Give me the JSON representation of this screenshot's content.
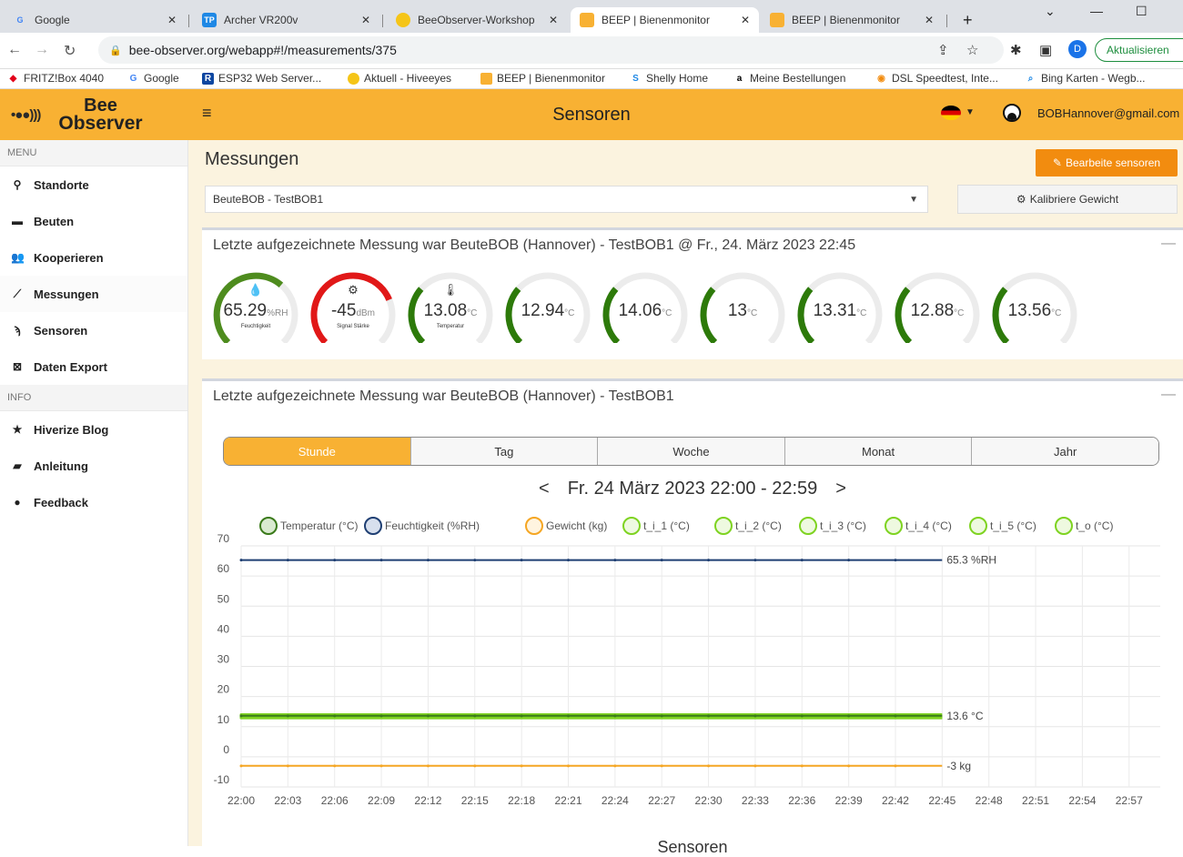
{
  "browser": {
    "tabs": [
      {
        "title": "Google",
        "icon": "G",
        "color": "#4285f4"
      },
      {
        "title": "Archer VR200v",
        "icon": "TP",
        "color": "#1e88e5"
      },
      {
        "title": "BeeObserver-Workshop",
        "icon": "",
        "color": "#f5c518"
      },
      {
        "title": "BEEP | Bienenmonitor",
        "icon": "",
        "color": "#f8b133"
      },
      {
        "title": "BEEP | Bienenmonitor",
        "icon": "",
        "color": "#f8b133"
      }
    ],
    "url": "bee-observer.org/webapp#!/measurements/375",
    "update_label": "Aktualisieren",
    "profile_initial": "D",
    "bookmarks": [
      "FRITZ!Box 4040",
      "Google",
      "ESP32 Web Server...",
      "Aktuell - Hiveeyes",
      "BEEP | Bienenmonitor",
      "Shelly Home",
      "Meine Bestellungen",
      "DSL Speedtest, Inte...",
      "Bing Karten - Wegb..."
    ]
  },
  "header": {
    "logo_line1": "Bee",
    "logo_line2": "Observer",
    "title": "Sensoren",
    "user_email": "BOBHannover@gmail.com"
  },
  "sidebar": {
    "menu_heading": "MENU",
    "info_heading": "INFO",
    "menu_items": [
      {
        "label": "Standorte",
        "icon": "map-marker-icon"
      },
      {
        "label": "Beuten",
        "icon": "archive-icon"
      },
      {
        "label": "Kooperieren",
        "icon": "users-icon"
      },
      {
        "label": "Messungen",
        "icon": "line-chart-icon"
      },
      {
        "label": "Sensoren",
        "icon": "rss-icon"
      },
      {
        "label": "Daten Export",
        "icon": "file-excel-icon"
      }
    ],
    "info_items": [
      {
        "label": "Hiverize Blog",
        "icon": "star-icon"
      },
      {
        "label": "Anleitung",
        "icon": "book-icon"
      },
      {
        "label": "Feedback",
        "icon": "comment-icon"
      }
    ]
  },
  "main": {
    "title": "Messungen",
    "edit_button": "Bearbeite sensoren",
    "calibrate_button": "Kalibriere Gewicht",
    "hive_selected": "BeuteBOB - TestBOB1",
    "last_measurement_title": "Letzte aufgezeichnete Messung war BeuteBOB (Hannover) - TestBOB1 @ Fr., 24. März 2023 22:45",
    "chart_panel_title": "Letzte aufgezeichnete Messung war BeuteBOB (Hannover) - TestBOB1",
    "period_tabs": [
      "Stunde",
      "Tag",
      "Woche",
      "Monat",
      "Jahr"
    ],
    "active_period": "Stunde",
    "date_range": "Fr. 24 März 2023 22:00 - 22:59",
    "prev_label": "<",
    "next_label": ">",
    "bottom_title": "Sensoren"
  },
  "gauges": [
    {
      "value": "65.29",
      "unit": "%RH",
      "label": "Feuchtigkeit",
      "icon": "humidity-icon",
      "glyph": "💧",
      "color": "#4e8c1e",
      "fraction": 0.65
    },
    {
      "value": "-45",
      "unit": "dBm",
      "label": "Signal Stärke",
      "icon": "gear-icon",
      "glyph": "⚙",
      "color": "#e11818",
      "fraction": 0.75
    },
    {
      "value": "13.08",
      "unit": "°C",
      "label": "Temperatur",
      "icon": "thermometer-icon",
      "glyph": "🌡",
      "color": "#2d7a0a",
      "fraction": 0.32
    },
    {
      "value": "12.94",
      "unit": "°C",
      "label": "",
      "icon": "",
      "glyph": "",
      "color": "#2d7a0a",
      "fraction": 0.32
    },
    {
      "value": "14.06",
      "unit": "°C",
      "label": "",
      "icon": "",
      "glyph": "",
      "color": "#2d7a0a",
      "fraction": 0.32
    },
    {
      "value": "13",
      "unit": "°C",
      "label": "",
      "icon": "",
      "glyph": "",
      "color": "#2d7a0a",
      "fraction": 0.32
    },
    {
      "value": "13.31",
      "unit": "°C",
      "label": "",
      "icon": "",
      "glyph": "",
      "color": "#2d7a0a",
      "fraction": 0.32
    },
    {
      "value": "12.88",
      "unit": "°C",
      "label": "",
      "icon": "",
      "glyph": "",
      "color": "#2d7a0a",
      "fraction": 0.32
    },
    {
      "value": "13.56",
      "unit": "°C",
      "label": "",
      "icon": "",
      "glyph": "",
      "color": "#2d7a0a",
      "fraction": 0.32
    }
  ],
  "chart_data": {
    "type": "line",
    "title": "",
    "xlabel": "",
    "ylabel": "",
    "ylim": [
      -10,
      70
    ],
    "yticks": [
      -10,
      0,
      10,
      20,
      30,
      40,
      50,
      60,
      70
    ],
    "x_ticks": [
      "22:00",
      "22:03",
      "22:06",
      "22:09",
      "22:12",
      "22:15",
      "22:18",
      "22:21",
      "22:24",
      "22:27",
      "22:30",
      "22:33",
      "22:36",
      "22:39",
      "22:42",
      "22:45",
      "22:48",
      "22:51",
      "22:54",
      "22:57"
    ],
    "grid": true,
    "legend_position": "top",
    "x_range_minutes": [
      0,
      59
    ],
    "series": [
      {
        "name": "Temperatur (°C)",
        "color": "#3a7a1a",
        "x_minutes": [
          0,
          45
        ],
        "values": [
          13.6,
          13.6
        ],
        "end_label": "13.6 °C"
      },
      {
        "name": "Feuchtigkeit (%RH)",
        "color": "#1f3f73",
        "x_minutes": [
          0,
          45
        ],
        "values": [
          65.3,
          65.3
        ],
        "end_label": "65.3 %RH"
      },
      {
        "name": "Gewicht (kg)",
        "color": "#f5a623",
        "x_minutes": [
          0,
          45
        ],
        "values": [
          -3,
          -3
        ],
        "end_label": "-3 kg"
      },
      {
        "name": "t_i_1 (°C)",
        "color": "#7ed321",
        "x_minutes": [
          0,
          45
        ],
        "values": [
          13,
          13
        ],
        "end_label": ""
      },
      {
        "name": "t_i_2 (°C)",
        "color": "#7ed321",
        "x_minutes": [
          0,
          45
        ],
        "values": [
          14,
          14
        ],
        "end_label": ""
      },
      {
        "name": "t_i_3 (°C)",
        "color": "#7ed321",
        "x_minutes": [
          0,
          45
        ],
        "values": [
          13,
          13
        ],
        "end_label": ""
      },
      {
        "name": "t_i_4 (°C)",
        "color": "#7ed321",
        "x_minutes": [
          0,
          45
        ],
        "values": [
          13.3,
          13.3
        ],
        "end_label": ""
      },
      {
        "name": "t_i_5 (°C)",
        "color": "#7ed321",
        "x_minutes": [
          0,
          45
        ],
        "values": [
          12.9,
          12.9
        ],
        "end_label": ""
      },
      {
        "name": "t_o (°C)",
        "color": "#7ed321",
        "x_minutes": [
          0,
          45
        ],
        "values": [
          13.6,
          13.6
        ],
        "end_label": ""
      }
    ]
  }
}
